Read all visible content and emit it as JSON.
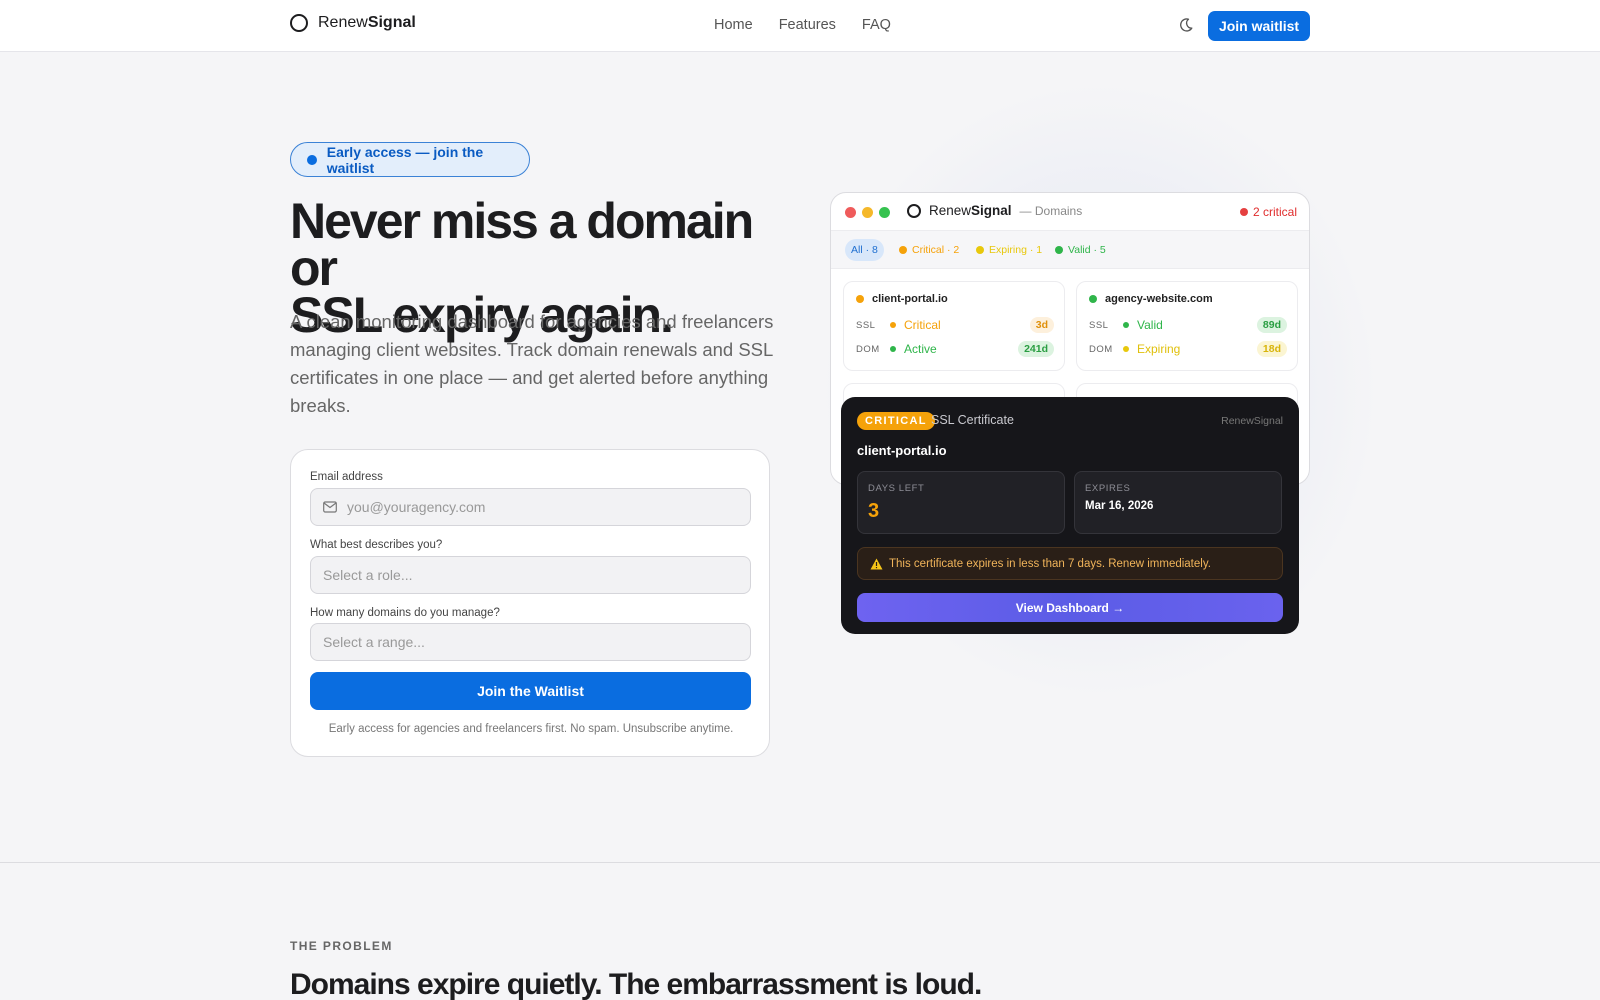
{
  "nav": {
    "brand_prefix": "Renew",
    "brand_suffix": "Signal",
    "links": [
      "Home",
      "Features",
      "FAQ"
    ],
    "cta": "Join waitlist",
    "theme_icon": "moon-icon"
  },
  "hero": {
    "pill": "Early access — join the waitlist",
    "title_line1": "Never miss a domain or",
    "title_line2": "SSL expiry again.",
    "subtitle": "A clean monitoring dashboard for agencies and freelancers managing client websites. Track domain renewals and SSL certificates in one place — and get alerted before anything breaks."
  },
  "form": {
    "email_label": "Email address",
    "email_placeholder": "you@youragency.com",
    "role_label": "What best describes you?",
    "role_value": "Select a role...",
    "domains_label": "How many domains do you manage?",
    "domains_value": "Select a range...",
    "submit": "Join the Waitlist",
    "note": "Early access for agencies and freelancers first. No spam. Unsubscribe anytime."
  },
  "dashboard": {
    "brand_prefix": "Renew",
    "brand_suffix": "Signal",
    "section": "— Domains",
    "critical_count": "2 critical",
    "filters": [
      {
        "label": "All · 8",
        "color": "#1f6fd0"
      },
      {
        "label": "Critical · 2",
        "color": "#f5a20a"
      },
      {
        "label": "Expiring · 1",
        "color": "#e8c80c"
      },
      {
        "label": "Valid · 5",
        "color": "#2fb54a"
      }
    ],
    "cards": [
      {
        "domain": "client-portal.io",
        "status_color": "#f5a20a",
        "rows": [
          {
            "tag": "SSL",
            "status": "Critical",
            "days": "3d",
            "color": "#f5a20a"
          },
          {
            "tag": "DOM",
            "status": "Active",
            "days": "241d",
            "color": "#2fb54a"
          }
        ]
      },
      {
        "domain": "agency-website.com",
        "status_color": "#2fb54a",
        "rows": [
          {
            "tag": "SSL",
            "status": "Valid",
            "days": "89d",
            "color": "#2fb54a"
          },
          {
            "tag": "DOM",
            "status": "Expiring",
            "days": "18d",
            "color": "#e8c80c"
          }
        ]
      }
    ]
  },
  "popup": {
    "badge": "CRITICAL",
    "type": "SSL Certificate",
    "brand": "RenewSignal",
    "domain": "client-portal.io",
    "days_left_label": "DAYS LEFT",
    "days_left": "3",
    "expires_label": "EXPIRES",
    "expires": "Mar 16, 2026",
    "warning": "This certificate expires in less than 7 days. Renew immediately.",
    "warning_icon": "warning-icon",
    "button": "View Dashboard →"
  },
  "problem": {
    "eyebrow": "THE PROBLEM",
    "title": "Domains expire quietly. The embarrassment is loud."
  }
}
